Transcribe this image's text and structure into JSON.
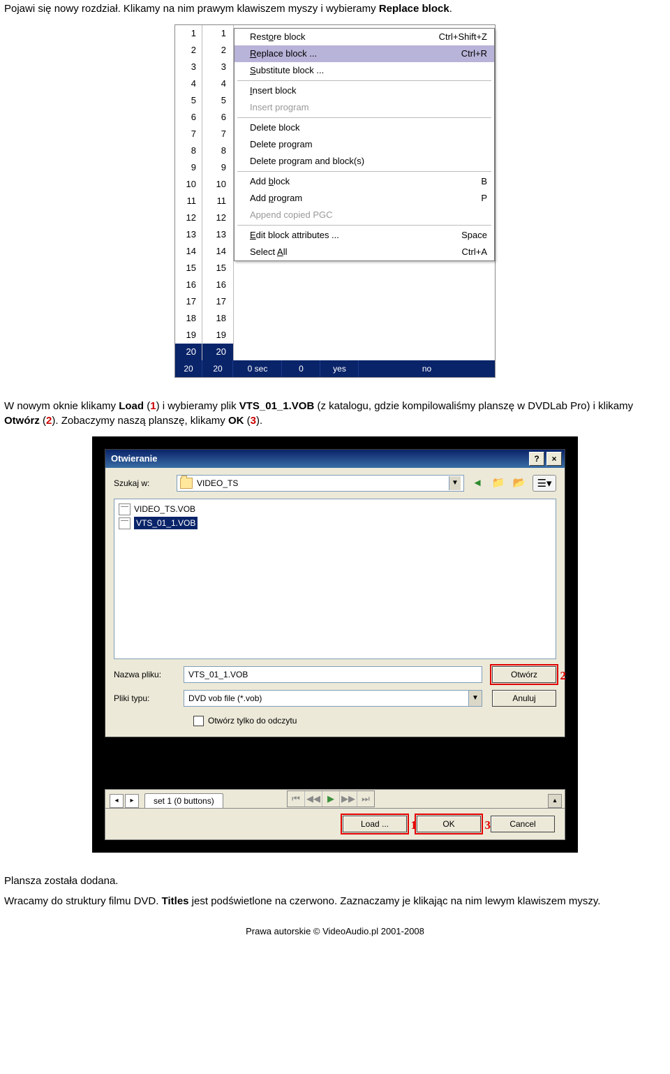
{
  "intro": {
    "p1a": "Pojawi się nowy rozdział. Klikamy na nim prawym klawiszem myszy i wybieramy",
    "p1b": "Replace block",
    "p1c": "."
  },
  "shot1": {
    "col1": [
      "1",
      "2",
      "3",
      "4",
      "5",
      "6",
      "7",
      "8",
      "9",
      "10",
      "11",
      "12",
      "13",
      "14",
      "15",
      "16",
      "17",
      "18",
      "19",
      "20"
    ],
    "col2": [
      "1",
      "2",
      "3",
      "4",
      "5",
      "6",
      "7",
      "8",
      "9",
      "10",
      "11",
      "12",
      "13",
      "14",
      "15",
      "16",
      "17",
      "18",
      "19",
      "20"
    ],
    "menu": {
      "restore": {
        "label": "Restore block",
        "u": "o",
        "shortcut": "Ctrl+Shift+Z"
      },
      "replace": {
        "label": "Replace block ...",
        "u": "R",
        "shortcut": "Ctrl+R"
      },
      "substitute": {
        "label": "Substitute block ...",
        "u": "S"
      },
      "insertblock": {
        "label": "Insert block",
        "u": "I"
      },
      "insertprog": {
        "label": "Insert program"
      },
      "deleteblock": {
        "label": "Delete block"
      },
      "deleteprog": {
        "label": "Delete program"
      },
      "deleteprogblk": {
        "label": "Delete program and block(s)"
      },
      "addblock": {
        "label": "Add block",
        "u": "b",
        "shortcut": "B"
      },
      "addprog": {
        "label": "Add program",
        "u": "p",
        "shortcut": "P"
      },
      "appendpgc": {
        "label": "Append copied PGC"
      },
      "editattrs": {
        "label": "Edit block attributes ...",
        "u": "E",
        "shortcut": "Space"
      },
      "selectall": {
        "label": "Select All",
        "u": "A",
        "shortcut": "Ctrl+A"
      }
    },
    "bottom": {
      "a": "20",
      "b": "20",
      "c": "0 sec",
      "d": "0",
      "e": "yes",
      "f": "no"
    }
  },
  "mid": {
    "p1a": "W nowym oknie klikamy ",
    "p1b": "Load",
    "p1c": " (",
    "p1d": "1",
    "p1e": ") i wybieramy plik ",
    "p1f": "VTS_01_1.VOB",
    "p1g": " (z katalogu, gdzie kompilowaliśmy planszę w DVDLab Pro) i klikamy ",
    "p1h": "Otwórz",
    "p1i": " (",
    "p1j": "2",
    "p1k": "). Zobaczymy naszą planszę, klikamy ",
    "p1l": "OK",
    "p1m": " (",
    "p1n": "3",
    "p1o": ")."
  },
  "dialog": {
    "title": "Otwieranie",
    "help": "?",
    "close": "×",
    "szukaj_label": "Szukaj w:",
    "folder": "VIDEO_TS",
    "files": [
      "VIDEO_TS.VOB",
      "VTS_01_1.VOB"
    ],
    "nazwa_label": "Nazwa pliku:",
    "nazwa_value": "VTS_01_1.VOB",
    "typ_label": "Pliki typu:",
    "typ_value": "DVD vob file (*.vob)",
    "open_btn": "Otwórz",
    "cancel_btn": "Anuluj",
    "readonly": "Otwórz tylko do odczytu",
    "annot2": "2"
  },
  "player": {
    "tab": "set 1 (0 buttons)",
    "load_btn": "Load ...",
    "ok_btn": "OK",
    "cancel_btn": "Cancel",
    "annot1": "1",
    "annot3": "3"
  },
  "outro": {
    "p1": "Plansza została dodana.",
    "p2a": "Wracamy do struktury filmu DVD. ",
    "p2b": "Titles",
    "p2c": " jest podświetlone na czerwono. Zaznaczamy je klikając na nim lewym klawiszem myszy."
  },
  "footer": "Prawa autorskie © VideoAudio.pl 2001-2008"
}
